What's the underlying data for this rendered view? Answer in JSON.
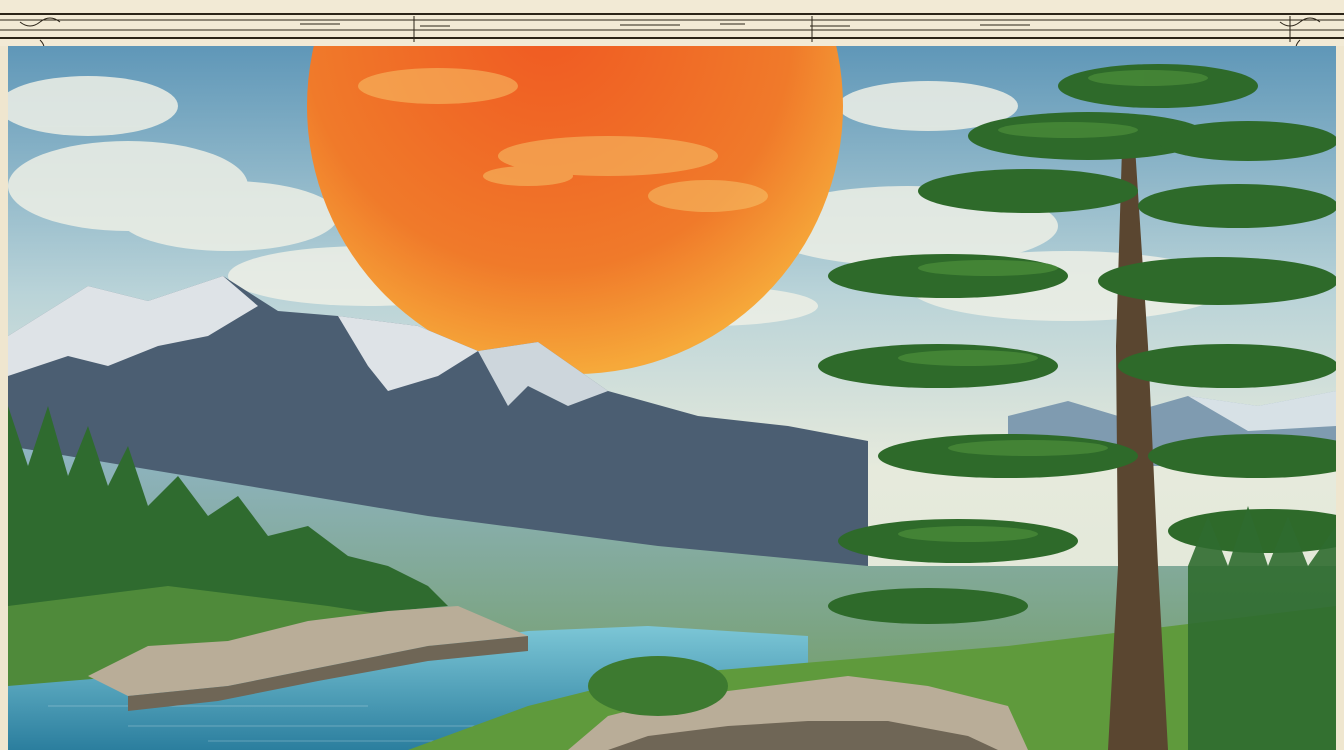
{
  "artwork": {
    "subject": "",
    "colors": {
      "frame": "#efe6cf",
      "frame_line": "#2b2418",
      "sky_top": "#5f97b8",
      "sky_mid": "#cde0e2",
      "sky_low": "#e6eadc",
      "planet_core": "#f05a22",
      "planet_edge": "#f6a93a",
      "mountain_dark": "#4b5e72",
      "mountain_snow": "#eef2f4",
      "valley_haze": "#8fb4c3",
      "forest": "#2f6b2f",
      "pine_foliage": "#2e6a2a",
      "pine_highlight": "#4d8f3a",
      "trunk": "#5a4630",
      "lake": "#4fb0c9",
      "lake_deep": "#2b7e9e",
      "rock": "#b9ad98",
      "rock_shadow": "#6f6656",
      "grass": "#5f9a3c"
    }
  }
}
